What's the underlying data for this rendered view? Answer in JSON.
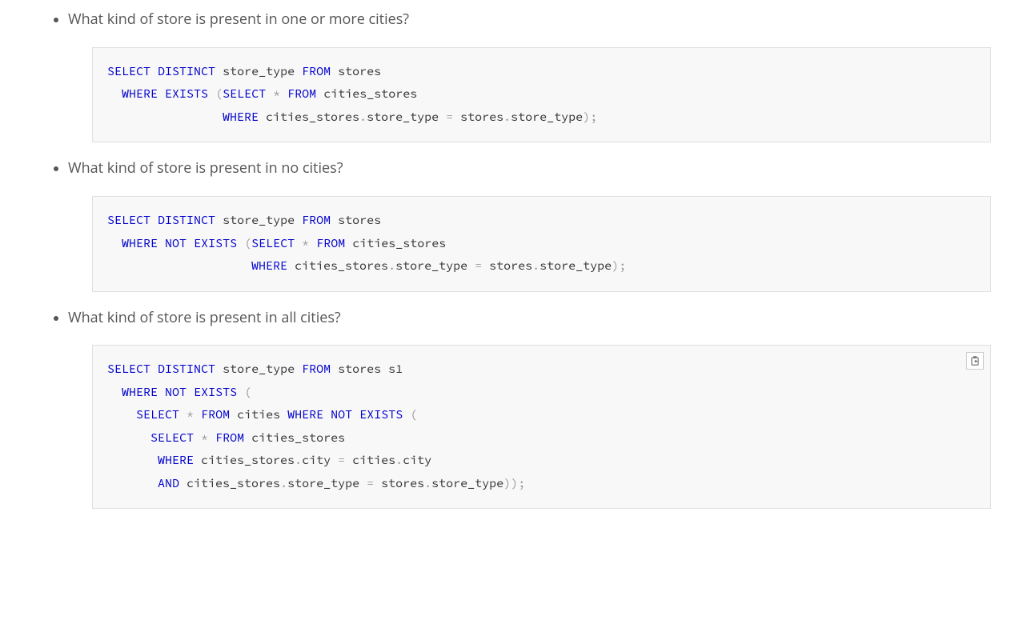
{
  "items": [
    {
      "question": "What kind of store is present in one or more cities?",
      "show_copy": false,
      "code": [
        {
          "t": "kw",
          "v": "SELECT"
        },
        {
          "t": "sp",
          "v": " "
        },
        {
          "t": "kw",
          "v": "DISTINCT"
        },
        {
          "t": "sp",
          "v": " "
        },
        {
          "t": "id",
          "v": "store_type"
        },
        {
          "t": "sp",
          "v": " "
        },
        {
          "t": "kw",
          "v": "FROM"
        },
        {
          "t": "sp",
          "v": " "
        },
        {
          "t": "id",
          "v": "stores"
        },
        {
          "t": "nl"
        },
        {
          "t": "sp",
          "v": "  "
        },
        {
          "t": "kw",
          "v": "WHERE"
        },
        {
          "t": "sp",
          "v": " "
        },
        {
          "t": "kw",
          "v": "EXISTS"
        },
        {
          "t": "sp",
          "v": " "
        },
        {
          "t": "op",
          "v": "("
        },
        {
          "t": "kw",
          "v": "SELECT"
        },
        {
          "t": "sp",
          "v": " "
        },
        {
          "t": "op",
          "v": "*"
        },
        {
          "t": "sp",
          "v": " "
        },
        {
          "t": "kw",
          "v": "FROM"
        },
        {
          "t": "sp",
          "v": " "
        },
        {
          "t": "id",
          "v": "cities_stores"
        },
        {
          "t": "nl"
        },
        {
          "t": "sp",
          "v": "                "
        },
        {
          "t": "kw",
          "v": "WHERE"
        },
        {
          "t": "sp",
          "v": " "
        },
        {
          "t": "id",
          "v": "cities_stores"
        },
        {
          "t": "op",
          "v": "."
        },
        {
          "t": "id",
          "v": "store_type"
        },
        {
          "t": "sp",
          "v": " "
        },
        {
          "t": "op",
          "v": "="
        },
        {
          "t": "sp",
          "v": " "
        },
        {
          "t": "id",
          "v": "stores"
        },
        {
          "t": "op",
          "v": "."
        },
        {
          "t": "id",
          "v": "store_type"
        },
        {
          "t": "op",
          "v": ")"
        },
        {
          "t": "op",
          "v": ";"
        }
      ]
    },
    {
      "question": "What kind of store is present in no cities?",
      "show_copy": false,
      "code": [
        {
          "t": "kw",
          "v": "SELECT"
        },
        {
          "t": "sp",
          "v": " "
        },
        {
          "t": "kw",
          "v": "DISTINCT"
        },
        {
          "t": "sp",
          "v": " "
        },
        {
          "t": "id",
          "v": "store_type"
        },
        {
          "t": "sp",
          "v": " "
        },
        {
          "t": "kw",
          "v": "FROM"
        },
        {
          "t": "sp",
          "v": " "
        },
        {
          "t": "id",
          "v": "stores"
        },
        {
          "t": "nl"
        },
        {
          "t": "sp",
          "v": "  "
        },
        {
          "t": "kw",
          "v": "WHERE"
        },
        {
          "t": "sp",
          "v": " "
        },
        {
          "t": "kw",
          "v": "NOT"
        },
        {
          "t": "sp",
          "v": " "
        },
        {
          "t": "kw",
          "v": "EXISTS"
        },
        {
          "t": "sp",
          "v": " "
        },
        {
          "t": "op",
          "v": "("
        },
        {
          "t": "kw",
          "v": "SELECT"
        },
        {
          "t": "sp",
          "v": " "
        },
        {
          "t": "op",
          "v": "*"
        },
        {
          "t": "sp",
          "v": " "
        },
        {
          "t": "kw",
          "v": "FROM"
        },
        {
          "t": "sp",
          "v": " "
        },
        {
          "t": "id",
          "v": "cities_stores"
        },
        {
          "t": "nl"
        },
        {
          "t": "sp",
          "v": "                    "
        },
        {
          "t": "kw",
          "v": "WHERE"
        },
        {
          "t": "sp",
          "v": " "
        },
        {
          "t": "id",
          "v": "cities_stores"
        },
        {
          "t": "op",
          "v": "."
        },
        {
          "t": "id",
          "v": "store_type"
        },
        {
          "t": "sp",
          "v": " "
        },
        {
          "t": "op",
          "v": "="
        },
        {
          "t": "sp",
          "v": " "
        },
        {
          "t": "id",
          "v": "stores"
        },
        {
          "t": "op",
          "v": "."
        },
        {
          "t": "id",
          "v": "store_type"
        },
        {
          "t": "op",
          "v": ")"
        },
        {
          "t": "op",
          "v": ";"
        }
      ]
    },
    {
      "question": "What kind of store is present in all cities?",
      "show_copy": true,
      "code": [
        {
          "t": "kw",
          "v": "SELECT"
        },
        {
          "t": "sp",
          "v": " "
        },
        {
          "t": "kw",
          "v": "DISTINCT"
        },
        {
          "t": "sp",
          "v": " "
        },
        {
          "t": "id",
          "v": "store_type"
        },
        {
          "t": "sp",
          "v": " "
        },
        {
          "t": "kw",
          "v": "FROM"
        },
        {
          "t": "sp",
          "v": " "
        },
        {
          "t": "id",
          "v": "stores s1"
        },
        {
          "t": "nl"
        },
        {
          "t": "sp",
          "v": "  "
        },
        {
          "t": "kw",
          "v": "WHERE"
        },
        {
          "t": "sp",
          "v": " "
        },
        {
          "t": "kw",
          "v": "NOT"
        },
        {
          "t": "sp",
          "v": " "
        },
        {
          "t": "kw",
          "v": "EXISTS"
        },
        {
          "t": "sp",
          "v": " "
        },
        {
          "t": "op",
          "v": "("
        },
        {
          "t": "nl"
        },
        {
          "t": "sp",
          "v": "    "
        },
        {
          "t": "kw",
          "v": "SELECT"
        },
        {
          "t": "sp",
          "v": " "
        },
        {
          "t": "op",
          "v": "*"
        },
        {
          "t": "sp",
          "v": " "
        },
        {
          "t": "kw",
          "v": "FROM"
        },
        {
          "t": "sp",
          "v": " "
        },
        {
          "t": "id",
          "v": "cities"
        },
        {
          "t": "sp",
          "v": " "
        },
        {
          "t": "kw",
          "v": "WHERE"
        },
        {
          "t": "sp",
          "v": " "
        },
        {
          "t": "kw",
          "v": "NOT"
        },
        {
          "t": "sp",
          "v": " "
        },
        {
          "t": "kw",
          "v": "EXISTS"
        },
        {
          "t": "sp",
          "v": " "
        },
        {
          "t": "op",
          "v": "("
        },
        {
          "t": "nl"
        },
        {
          "t": "sp",
          "v": "      "
        },
        {
          "t": "kw",
          "v": "SELECT"
        },
        {
          "t": "sp",
          "v": " "
        },
        {
          "t": "op",
          "v": "*"
        },
        {
          "t": "sp",
          "v": " "
        },
        {
          "t": "kw",
          "v": "FROM"
        },
        {
          "t": "sp",
          "v": " "
        },
        {
          "t": "id",
          "v": "cities_stores"
        },
        {
          "t": "nl"
        },
        {
          "t": "sp",
          "v": "       "
        },
        {
          "t": "kw",
          "v": "WHERE"
        },
        {
          "t": "sp",
          "v": " "
        },
        {
          "t": "id",
          "v": "cities_stores"
        },
        {
          "t": "op",
          "v": "."
        },
        {
          "t": "id",
          "v": "city"
        },
        {
          "t": "sp",
          "v": " "
        },
        {
          "t": "op",
          "v": "="
        },
        {
          "t": "sp",
          "v": " "
        },
        {
          "t": "id",
          "v": "cities"
        },
        {
          "t": "op",
          "v": "."
        },
        {
          "t": "id",
          "v": "city"
        },
        {
          "t": "nl"
        },
        {
          "t": "sp",
          "v": "       "
        },
        {
          "t": "kw",
          "v": "AND"
        },
        {
          "t": "sp",
          "v": " "
        },
        {
          "t": "id",
          "v": "cities_stores"
        },
        {
          "t": "op",
          "v": "."
        },
        {
          "t": "id",
          "v": "store_type"
        },
        {
          "t": "sp",
          "v": " "
        },
        {
          "t": "op",
          "v": "="
        },
        {
          "t": "sp",
          "v": " "
        },
        {
          "t": "id",
          "v": "stores"
        },
        {
          "t": "op",
          "v": "."
        },
        {
          "t": "id",
          "v": "store_type"
        },
        {
          "t": "op",
          "v": ")"
        },
        {
          "t": "op",
          "v": ")"
        },
        {
          "t": "op",
          "v": ";"
        }
      ]
    }
  ]
}
